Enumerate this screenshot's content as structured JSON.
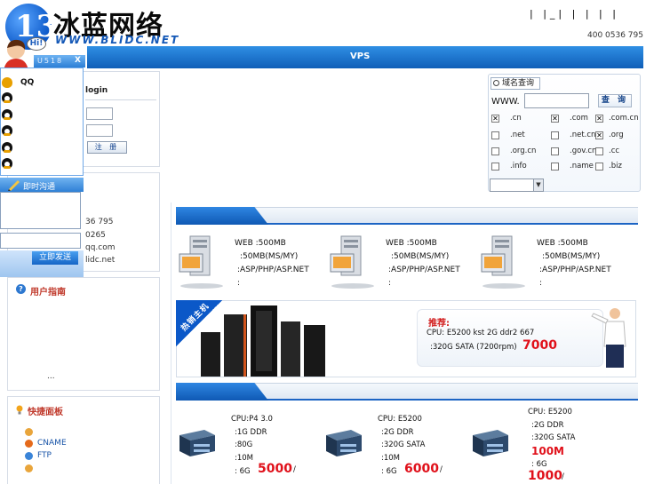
{
  "header": {
    "logo_letter": "13",
    "logo_text": "冰蓝网络",
    "logo_url": "WWW.BLIDC.NET",
    "top_links": "|   |_|  |  |  |  |",
    "phone": "400 0536 795"
  },
  "nav": {
    "title": "VPS"
  },
  "qq_float": {
    "hi": "Hi!",
    "head_text": "U518",
    "close": "X",
    "qq_label": "QQ",
    "chat_title": "即时沟通",
    "send_label": "立即发送"
  },
  "login": {
    "title": "login",
    "register_label": "注 册"
  },
  "contact": {
    "lines": [
      "36 795",
      "0265",
      "qq.com",
      "lidc.net"
    ]
  },
  "guide": {
    "title": "用户指南",
    "ellipsis": "..."
  },
  "quick": {
    "title": "快捷面板",
    "items": [
      "",
      "CNAME",
      "FTP",
      ""
    ]
  },
  "domain": {
    "tab_label": "域名查询",
    "prefix": "WWW.",
    "search_label": "查 询",
    "tlds": [
      {
        "name": ".cn",
        "checked": true
      },
      {
        "name": ".com",
        "checked": true
      },
      {
        "name": ".com.cn",
        "checked": true
      },
      {
        "name": ".net",
        "checked": false
      },
      {
        "name": ".net.cn",
        "checked": false
      },
      {
        "name": ".org",
        "checked": true
      },
      {
        "name": ".org.cn",
        "checked": false
      },
      {
        "name": ".gov.cn",
        "checked": false
      },
      {
        "name": ".cc",
        "checked": false
      },
      {
        "name": ".info",
        "checked": false
      },
      {
        "name": ".name",
        "checked": false
      },
      {
        "name": ".biz",
        "checked": false
      }
    ],
    "select_value": ""
  },
  "vps": {
    "products": [
      {
        "web": "WEB  :500MB",
        "db": ":50MB(MS/MY)",
        "lang": ":ASP/PHP/ASP.NET",
        "extra": ":"
      },
      {
        "web": "WEB  :500MB",
        "db": ":50MB(MS/MY)",
        "lang": ":ASP/PHP/ASP.NET",
        "extra": ":"
      },
      {
        "web": "WEB  :500MB",
        "db": ":50MB(MS/MY)",
        "lang": ":ASP/PHP/ASP.NET",
        "extra": ":"
      }
    ]
  },
  "promo": {
    "ribbon": "热销主机",
    "head": "推荐:",
    "line1": "CPU:  E5200     kst 2G ddr2 667",
    "line2": ":320G SATA (7200rpm)",
    "price": "7000"
  },
  "servers": [
    {
      "cpu": "CPU:P4 3.0",
      "ram": ":1G DDR",
      "disk": ":80G",
      "bw": ":10M",
      "ip": ": 6G",
      "price": "5000",
      "unit": "/"
    },
    {
      "cpu": "CPU:  E5200",
      "ram": ":2G DDR",
      "disk": ":320G SATA",
      "bw": ":10M",
      "ip": ": 6G",
      "price": "6000",
      "unit": "/"
    },
    {
      "cpu": "CPU:  E5200",
      "ram": ":2G DDR",
      "disk": ":320G SATA",
      "bw": "100M",
      "ip": ": 6G",
      "price": "1000",
      "unit": "/"
    }
  ],
  "colors": {
    "brand_blue": "#1565c6",
    "price_red": "#e0101a"
  }
}
